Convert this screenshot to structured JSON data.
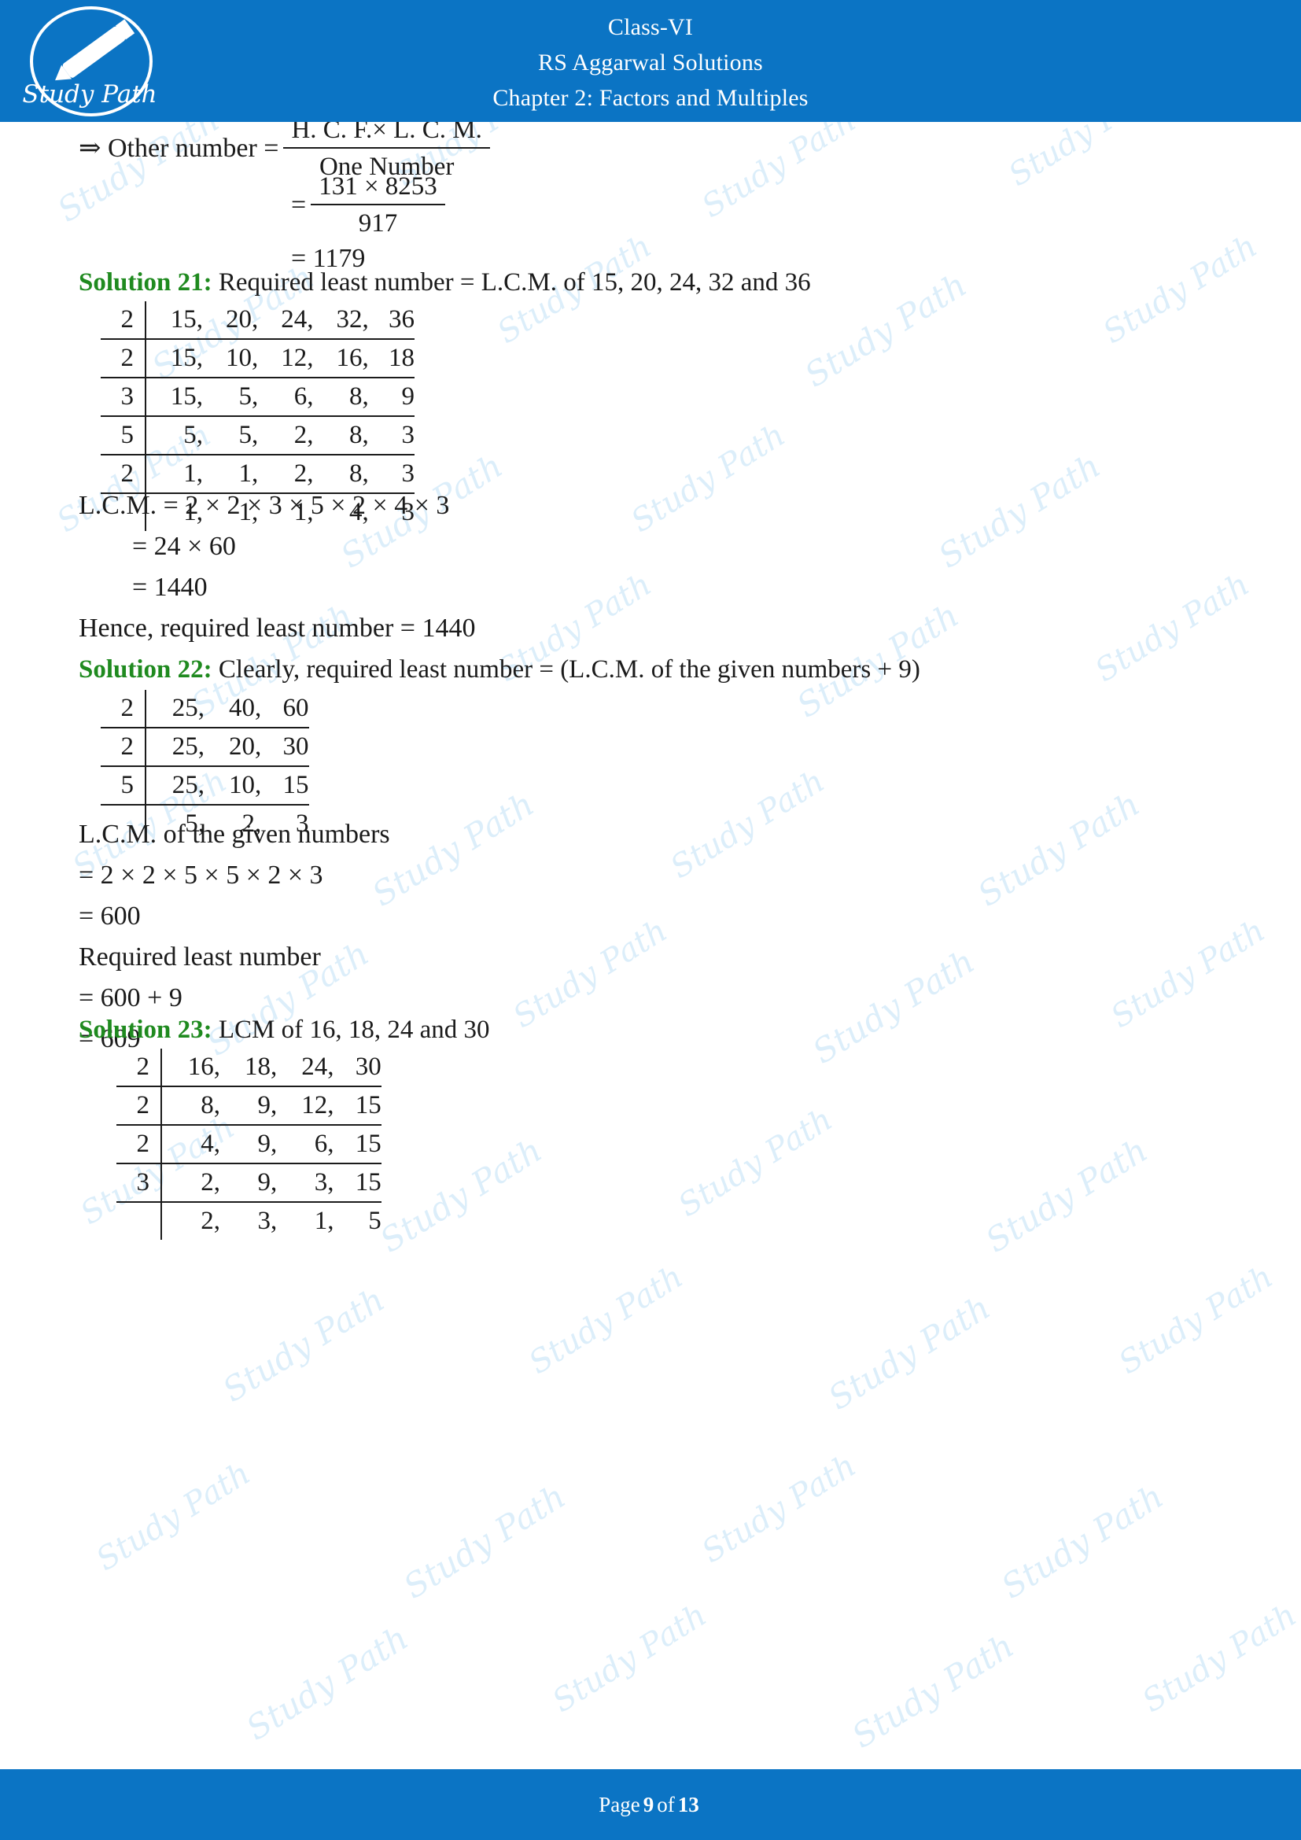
{
  "header": {
    "logo_text": "Study Path",
    "line1": "Class-VI",
    "line2": "RS Aggarwal Solutions",
    "line3": "Chapter 2: Factors and Multiples"
  },
  "footer": {
    "prefix": "Page",
    "page_number": "9",
    "middle": "of",
    "total_pages": "13"
  },
  "colors": {
    "brand_blue": "#0b74c4",
    "solution_green": "#1f8a1f",
    "body_text": "#1b1b1b",
    "watermark": "#d6ecfa"
  },
  "watermark_text": "Study Path",
  "top_derivation": {
    "line1_prefix": "⇒ Other number =",
    "frac1_num": "H. C. F.×  L. C. M.",
    "frac1_den": "One Number",
    "eq2_sign": "=",
    "frac2_num": "131 × 8253",
    "frac2_den": "917",
    "eq3": "= 1179"
  },
  "solutions": [
    {
      "tag": "Solution 21:",
      "statement": "Required least number = L.C.M. of 15, 20, 24, 32 and 36",
      "ladder": {
        "rows": [
          {
            "divisor": "2",
            "values": [
              "15,",
              "20,",
              "24,",
              "32,",
              "36"
            ]
          },
          {
            "divisor": "2",
            "values": [
              "15,",
              "10,",
              "12,",
              "16,",
              "18"
            ]
          },
          {
            "divisor": "3",
            "values": [
              "15,",
              "5,",
              "6,",
              "8,",
              "9"
            ]
          },
          {
            "divisor": "5",
            "values": [
              "5,",
              "5,",
              "2,",
              "8,",
              "3"
            ]
          },
          {
            "divisor": "2",
            "values": [
              "1,",
              "1,",
              "2,",
              "8,",
              "3"
            ]
          },
          {
            "divisor": "",
            "values": [
              "1,",
              "1,",
              "1,",
              "4,",
              "3"
            ]
          }
        ]
      },
      "after_lines": [
        "L.C.M. = 2 × 2 × 3 × 5 × 2 × 4 × 3",
        "= 24 × 60",
        "= 1440",
        "Hence, required least number = 1440"
      ]
    },
    {
      "tag": "Solution 22:",
      "statement": "Clearly, required least number = (L.C.M. of the given numbers + 9)",
      "ladder": {
        "rows": [
          {
            "divisor": "2",
            "values": [
              "25,",
              "40,",
              "60"
            ]
          },
          {
            "divisor": "2",
            "values": [
              "25,",
              "20,",
              "30"
            ]
          },
          {
            "divisor": "5",
            "values": [
              "25,",
              "10,",
              "15"
            ]
          },
          {
            "divisor": "",
            "values": [
              "5,",
              "2,",
              "3"
            ]
          }
        ]
      },
      "after_lines": [
        "L.C.M. of the given numbers",
        "= 2 × 2 × 5 × 5 × 2 × 3",
        "= 600",
        "Required least number",
        "= 600 + 9",
        "= 609"
      ]
    },
    {
      "tag": "Solution 23:",
      "statement": "LCM of 16, 18, 24 and 30",
      "ladder": {
        "rows": [
          {
            "divisor": "2",
            "values": [
              "16,",
              "18,",
              "24,",
              "30"
            ]
          },
          {
            "divisor": "2",
            "values": [
              "8,",
              "9,",
              "12,",
              "15"
            ]
          },
          {
            "divisor": "2",
            "values": [
              "4,",
              "9,",
              "6,",
              "15"
            ]
          },
          {
            "divisor": "3",
            "values": [
              "2,",
              "9,",
              "3,",
              "15"
            ]
          },
          {
            "divisor": "",
            "values": [
              "2,",
              "3,",
              "1,",
              "5"
            ]
          }
        ]
      },
      "after_lines": []
    }
  ]
}
